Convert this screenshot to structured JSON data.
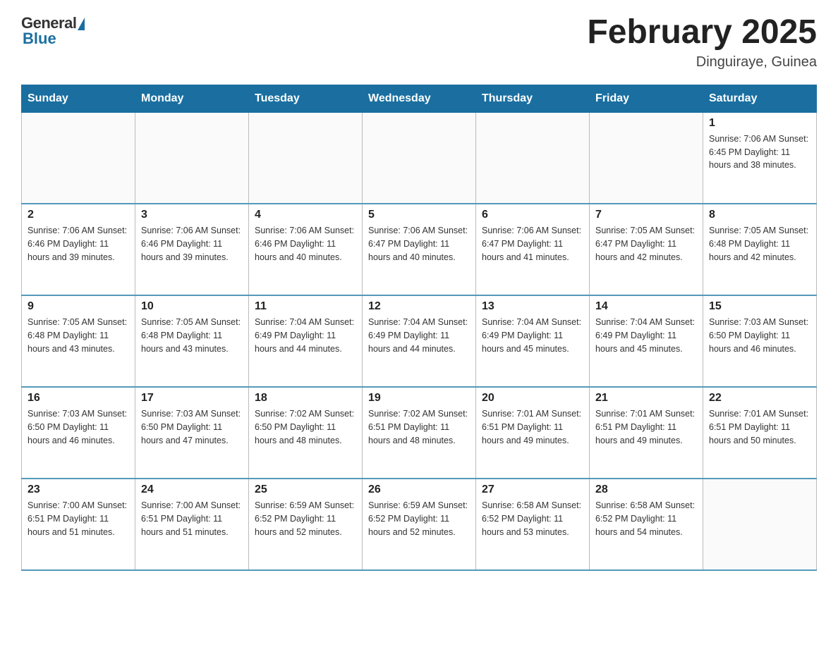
{
  "header": {
    "logo_general": "General",
    "logo_blue": "Blue",
    "main_title": "February 2025",
    "subtitle": "Dinguiraye, Guinea"
  },
  "days_of_week": [
    "Sunday",
    "Monday",
    "Tuesday",
    "Wednesday",
    "Thursday",
    "Friday",
    "Saturday"
  ],
  "weeks": [
    [
      {
        "day": "",
        "info": ""
      },
      {
        "day": "",
        "info": ""
      },
      {
        "day": "",
        "info": ""
      },
      {
        "day": "",
        "info": ""
      },
      {
        "day": "",
        "info": ""
      },
      {
        "day": "",
        "info": ""
      },
      {
        "day": "1",
        "info": "Sunrise: 7:06 AM\nSunset: 6:45 PM\nDaylight: 11 hours and 38 minutes."
      }
    ],
    [
      {
        "day": "2",
        "info": "Sunrise: 7:06 AM\nSunset: 6:46 PM\nDaylight: 11 hours and 39 minutes."
      },
      {
        "day": "3",
        "info": "Sunrise: 7:06 AM\nSunset: 6:46 PM\nDaylight: 11 hours and 39 minutes."
      },
      {
        "day": "4",
        "info": "Sunrise: 7:06 AM\nSunset: 6:46 PM\nDaylight: 11 hours and 40 minutes."
      },
      {
        "day": "5",
        "info": "Sunrise: 7:06 AM\nSunset: 6:47 PM\nDaylight: 11 hours and 40 minutes."
      },
      {
        "day": "6",
        "info": "Sunrise: 7:06 AM\nSunset: 6:47 PM\nDaylight: 11 hours and 41 minutes."
      },
      {
        "day": "7",
        "info": "Sunrise: 7:05 AM\nSunset: 6:47 PM\nDaylight: 11 hours and 42 minutes."
      },
      {
        "day": "8",
        "info": "Sunrise: 7:05 AM\nSunset: 6:48 PM\nDaylight: 11 hours and 42 minutes."
      }
    ],
    [
      {
        "day": "9",
        "info": "Sunrise: 7:05 AM\nSunset: 6:48 PM\nDaylight: 11 hours and 43 minutes."
      },
      {
        "day": "10",
        "info": "Sunrise: 7:05 AM\nSunset: 6:48 PM\nDaylight: 11 hours and 43 minutes."
      },
      {
        "day": "11",
        "info": "Sunrise: 7:04 AM\nSunset: 6:49 PM\nDaylight: 11 hours and 44 minutes."
      },
      {
        "day": "12",
        "info": "Sunrise: 7:04 AM\nSunset: 6:49 PM\nDaylight: 11 hours and 44 minutes."
      },
      {
        "day": "13",
        "info": "Sunrise: 7:04 AM\nSunset: 6:49 PM\nDaylight: 11 hours and 45 minutes."
      },
      {
        "day": "14",
        "info": "Sunrise: 7:04 AM\nSunset: 6:49 PM\nDaylight: 11 hours and 45 minutes."
      },
      {
        "day": "15",
        "info": "Sunrise: 7:03 AM\nSunset: 6:50 PM\nDaylight: 11 hours and 46 minutes."
      }
    ],
    [
      {
        "day": "16",
        "info": "Sunrise: 7:03 AM\nSunset: 6:50 PM\nDaylight: 11 hours and 46 minutes."
      },
      {
        "day": "17",
        "info": "Sunrise: 7:03 AM\nSunset: 6:50 PM\nDaylight: 11 hours and 47 minutes."
      },
      {
        "day": "18",
        "info": "Sunrise: 7:02 AM\nSunset: 6:50 PM\nDaylight: 11 hours and 48 minutes."
      },
      {
        "day": "19",
        "info": "Sunrise: 7:02 AM\nSunset: 6:51 PM\nDaylight: 11 hours and 48 minutes."
      },
      {
        "day": "20",
        "info": "Sunrise: 7:01 AM\nSunset: 6:51 PM\nDaylight: 11 hours and 49 minutes."
      },
      {
        "day": "21",
        "info": "Sunrise: 7:01 AM\nSunset: 6:51 PM\nDaylight: 11 hours and 49 minutes."
      },
      {
        "day": "22",
        "info": "Sunrise: 7:01 AM\nSunset: 6:51 PM\nDaylight: 11 hours and 50 minutes."
      }
    ],
    [
      {
        "day": "23",
        "info": "Sunrise: 7:00 AM\nSunset: 6:51 PM\nDaylight: 11 hours and 51 minutes."
      },
      {
        "day": "24",
        "info": "Sunrise: 7:00 AM\nSunset: 6:51 PM\nDaylight: 11 hours and 51 minutes."
      },
      {
        "day": "25",
        "info": "Sunrise: 6:59 AM\nSunset: 6:52 PM\nDaylight: 11 hours and 52 minutes."
      },
      {
        "day": "26",
        "info": "Sunrise: 6:59 AM\nSunset: 6:52 PM\nDaylight: 11 hours and 52 minutes."
      },
      {
        "day": "27",
        "info": "Sunrise: 6:58 AM\nSunset: 6:52 PM\nDaylight: 11 hours and 53 minutes."
      },
      {
        "day": "28",
        "info": "Sunrise: 6:58 AM\nSunset: 6:52 PM\nDaylight: 11 hours and 54 minutes."
      },
      {
        "day": "",
        "info": ""
      }
    ]
  ]
}
